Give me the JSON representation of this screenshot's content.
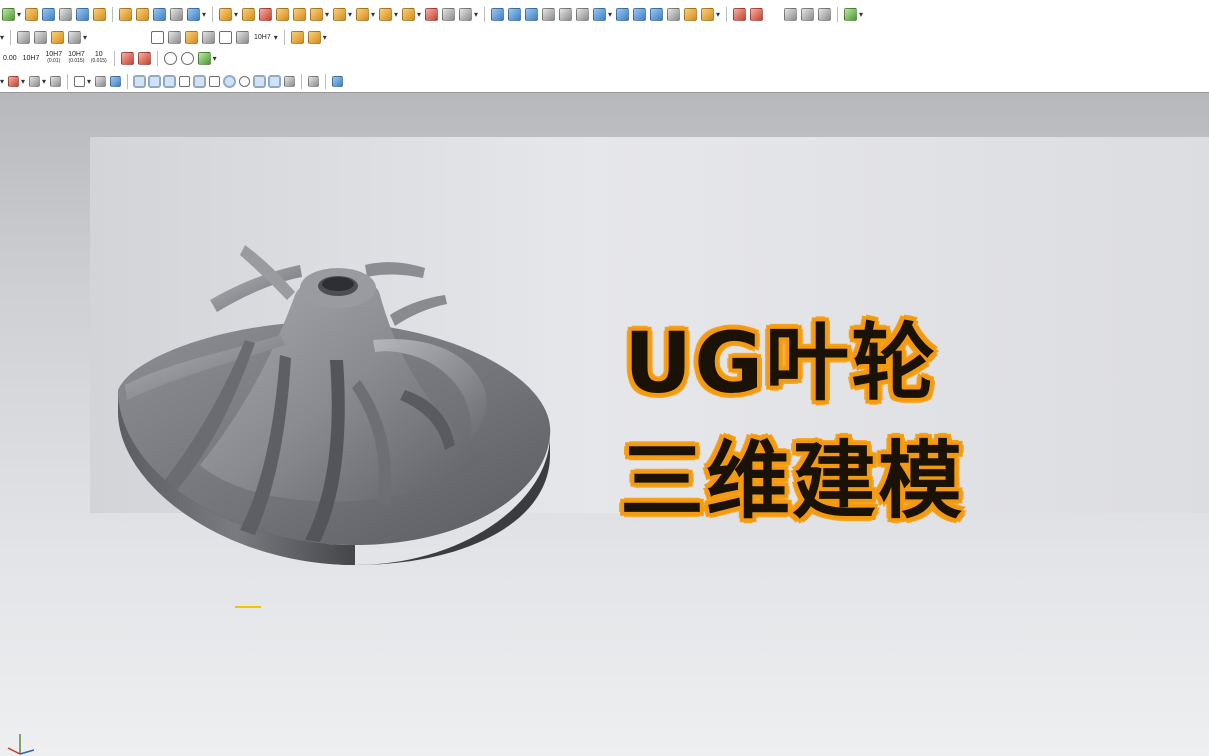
{
  "window": {
    "title": "",
    "accent_color": "#f39a11"
  },
  "toolbars": {
    "row1": {
      "icon_names": [
        "sketch-icon",
        "extrude-icon",
        "revolve-icon",
        "hole-icon",
        "boss-icon",
        "block-icon",
        "edge-blend-icon",
        "chamfer-icon",
        "shell-icon",
        "draft-icon",
        "unite-icon",
        "subtract-icon",
        "intersect-icon",
        "trim-body-icon",
        "offset-face-icon",
        "sweep-icon",
        "through-curves-icon",
        "n-sided-surface-icon",
        "surface-edit-icon",
        "move-face-icon",
        "replace-face-icon",
        "synchronous-icon",
        "wave-icon",
        "fit-curve-icon",
        "bridge-icon",
        "extension-icon",
        "first-frame-icon",
        "prev-frame-icon",
        "next-frame-icon",
        "last-frame-icon",
        "play-icon",
        "analysis-icon"
      ]
    },
    "row2": {
      "icon_names": [
        "layer-icon",
        "measure-icon",
        "color-icon",
        "ruler-icon",
        "triangle-icon",
        "table-icon",
        "dimension-icon",
        "grid-icon",
        "drafting-icon",
        "note-icon",
        "hole-callout-icon",
        "assembly-icon",
        "component-icon"
      ],
      "hole_callout_label": "10H7"
    },
    "row3": {
      "tolerance_labels": [
        "0.00",
        "10H7",
        "10H7",
        "10H7",
        "10"
      ],
      "tolerance_sub": [
        "",
        "",
        "(0.01)",
        "(0.015)",
        "(0.015)"
      ],
      "icon_names": [
        "datum-feature-icon",
        "feature-control-frame-icon",
        "diameter-icon",
        "radius-icon",
        "undo-arrow-icon"
      ]
    },
    "row4": {
      "icon_names": [
        "snap-point-icon",
        "snap-end-icon",
        "snap-mid-icon",
        "snap-center-icon",
        "snap-intersection-icon",
        "snap-tangent-icon",
        "snap-quadrant-icon",
        "snap-exist-icon",
        "snap-on-curve-icon",
        "filter-icon",
        "selection-icon"
      ]
    }
  },
  "cover": {
    "title_line1": "UG叶轮",
    "title_line2": "三维建模"
  },
  "model": {
    "description_icon": "impeller-model",
    "blade_count": 11
  },
  "colors": {
    "title_fill": "#1a1207",
    "title_outline": "#f39a11",
    "viewport_top": "#b7b8bc",
    "viewport_bottom": "#eeeff1",
    "model_dark": "#4a4b4f",
    "model_light": "#a9aaae"
  }
}
